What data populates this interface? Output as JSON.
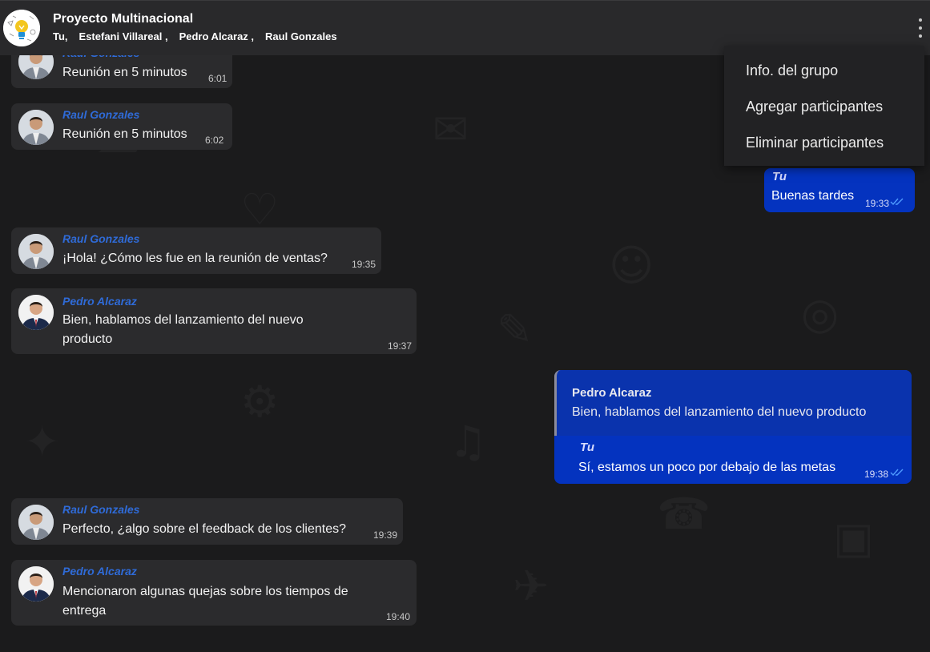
{
  "header": {
    "title": "Proyecto Multinacional",
    "members": [
      "Tu,",
      "Estefani Villareal ,",
      "Pedro Alcaraz ,",
      "Raul Gonzales"
    ]
  },
  "menu": {
    "items": [
      "Info. del grupo",
      "Agregar participantes",
      "Eliminar participantes"
    ]
  },
  "messages": [
    {
      "sender": "Raul Gonzales",
      "text": "Reunión en 5 minutos",
      "time": "6:01"
    },
    {
      "sender": "Raul Gonzales",
      "text": "Reunión en 5 minutos",
      "time": "6:02"
    },
    {
      "sender": "Tu",
      "text": "Buenas tardes",
      "time": "19:33"
    },
    {
      "sender": "Raul Gonzales",
      "text": "¡Hola! ¿Cómo les fue en la reunión de ventas?",
      "time": "19:35"
    },
    {
      "sender": "Pedro Alcaraz",
      "text_lines": [
        "Bien, hablamos del lanzamiento del nuevo",
        "producto"
      ],
      "time": "19:37"
    },
    {
      "quote_sender": "Pedro Alcaraz",
      "quote_text": "Bien, hablamos del lanzamiento del nuevo producto",
      "sender": "Tu",
      "text": "Sí, estamos un poco por debajo de las metas",
      "time": "19:38"
    },
    {
      "sender": "Raul Gonzales",
      "text": "Perfecto, ¿algo sobre el feedback de los clientes?",
      "time": "19:39"
    },
    {
      "sender": "Pedro Alcaraz",
      "text_lines": [
        "Mencionaron algunas quejas sobre los tiempos de",
        "entrega"
      ],
      "time": "19:40"
    }
  ],
  "colors": {
    "background": "#1b1b1c",
    "header": "#29292b",
    "incoming_bubble": "#2b2b2d",
    "outgoing_bubble": "#0433bf",
    "sender_name": "#2f6bd8",
    "read_ticks": "#4f9bff"
  },
  "icons": {
    "menu": "more-vertical-icon",
    "read_receipt": "double-check-icon",
    "group_avatar": "lightbulb-icon"
  }
}
